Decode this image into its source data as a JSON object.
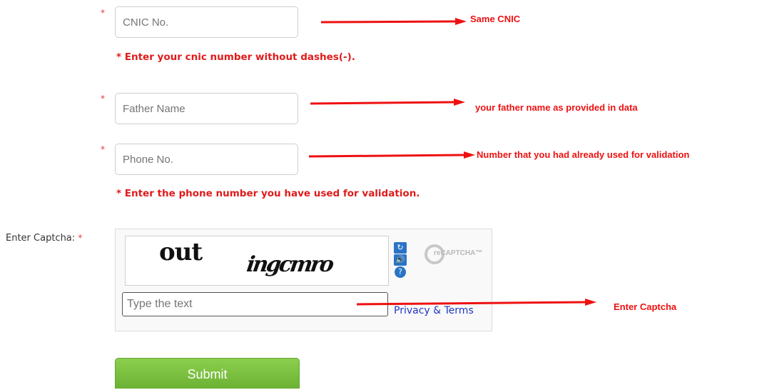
{
  "form": {
    "required_mark": "*",
    "cnic": {
      "placeholder": "CNIC No.",
      "hint": "* Enter your cnic number without dashes(-)."
    },
    "father": {
      "placeholder": "Father Name"
    },
    "phone": {
      "placeholder": "Phone No.",
      "hint": "* Enter the phone number you have used for validation."
    },
    "captcha": {
      "label": "Enter Captcha:",
      "word1": "out",
      "word2": "ingcmro",
      "input_placeholder": "Type the text",
      "privacy_link": "Privacy & Terms",
      "logo_text": "reCAPTCHA™"
    },
    "submit_label": "Submit"
  },
  "annotations": {
    "cnic": "Same CNIC",
    "father": "your father name as provided in data",
    "phone": "Number that you had already used for validation",
    "captcha": "Enter Captcha"
  },
  "colors": {
    "annotation": "#ee1111",
    "required": "#e33333",
    "submit": "#7cc042",
    "link": "#2236c4"
  }
}
